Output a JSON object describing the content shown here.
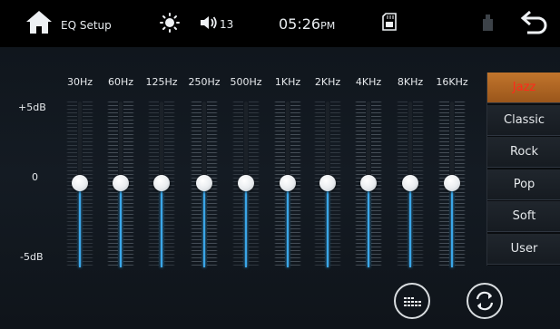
{
  "header": {
    "title": "EQ Setup",
    "volume": "13",
    "time": "05:26",
    "ampm": "PM",
    "icons": [
      "home-icon",
      "brightness-icon",
      "volume-icon",
      "sd-card-icon",
      "usb-icon",
      "back-icon"
    ]
  },
  "eq": {
    "level_labels": {
      "top": "+5dB",
      "mid": "0",
      "bottom": "-5dB"
    },
    "bands": [
      {
        "label": "30Hz",
        "gain_db": 0
      },
      {
        "label": "60Hz",
        "gain_db": 0
      },
      {
        "label": "125Hz",
        "gain_db": 0
      },
      {
        "label": "250Hz",
        "gain_db": 0
      },
      {
        "label": "500Hz",
        "gain_db": 0
      },
      {
        "label": "1KHz",
        "gain_db": 0
      },
      {
        "label": "2KHz",
        "gain_db": 0
      },
      {
        "label": "4KHz",
        "gain_db": 0
      },
      {
        "label": "8KHz",
        "gain_db": 0
      },
      {
        "label": "16KHz",
        "gain_db": 0
      }
    ]
  },
  "presets": {
    "items": [
      "Jazz",
      "Classic",
      "Rock",
      "Pop",
      "Soft",
      "User"
    ],
    "selected": "Jazz"
  },
  "colors": {
    "accent_blue": "#3aa6e8",
    "preset_active_bg": "#b0642a",
    "preset_active_text": "#ff2a1a"
  },
  "footer": {
    "icons": [
      "equalizer-icon",
      "reset-icon"
    ]
  }
}
